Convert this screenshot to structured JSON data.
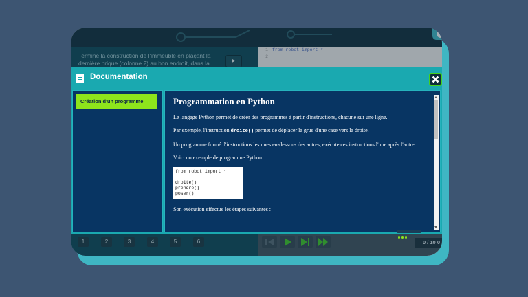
{
  "background_app": {
    "task_text": "Termine la construction de l'immeuble en plaçant la dernière brique (colonne 2) au bon endroit, dans la",
    "run_label": "▸",
    "code_lines": [
      {
        "num": "1",
        "text": "from robot import *"
      },
      {
        "num": "2",
        "text": ""
      }
    ],
    "columns": [
      "1",
      "2",
      "3",
      "4",
      "5",
      "6"
    ],
    "step_counter": "0 / 10 0"
  },
  "modal": {
    "title": "Documentation",
    "sidebar": {
      "items": [
        {
          "label": "Création d'un programme",
          "active": true
        }
      ]
    },
    "content": {
      "heading": "Programmation en Python",
      "p1": "Le langage Python permet de créer des programmes à partir d'instructions, chacune sur une ligne.",
      "p2_before": "Par exemple, l'instruction ",
      "p2_code": "droite()",
      "p2_after": " permet de déplacer la grue d'une case vers la droite.",
      "p3": "Un programme formé d'instructions les unes en-dessous des autres, exécute ces instructions l'une après l'autre.",
      "p4": "Voici un exemple de programme Python :",
      "code_example": "from robot import *\n\ndroite()\nprendre()\nposer()",
      "p5": "Son exécution effectue les étapes suivantes :"
    }
  },
  "colors": {
    "page_bg": "#3d5572",
    "teal": "#1aa9b0",
    "navy": "#083563",
    "green": "#8ee51c"
  }
}
